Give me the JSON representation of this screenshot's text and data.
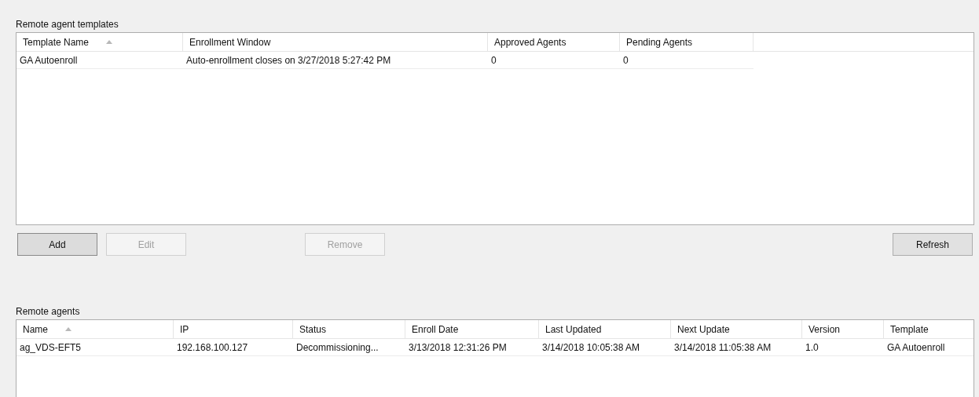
{
  "templates": {
    "label": "Remote agent templates",
    "columns": [
      {
        "title": "Template Name",
        "sorted": true
      },
      {
        "title": "Enrollment Window",
        "sorted": false
      },
      {
        "title": "Approved Agents",
        "sorted": false
      },
      {
        "title": "Pending Agents",
        "sorted": false
      }
    ],
    "rows": [
      [
        "GA Autoenroll",
        "Auto-enrollment closes on 3/27/2018 5:27:42 PM",
        "0",
        "0"
      ]
    ]
  },
  "buttons": [
    {
      "label": "Add",
      "disabled": false,
      "default": true
    },
    {
      "label": "Edit",
      "disabled": true,
      "default": false
    },
    {
      "label": "Remove",
      "disabled": true,
      "default": false
    },
    {
      "label": "Refresh",
      "disabled": false,
      "default": false
    }
  ],
  "agents": {
    "label": "Remote agents",
    "columns": [
      {
        "title": "Name",
        "sorted": true
      },
      {
        "title": "IP",
        "sorted": false
      },
      {
        "title": "Status",
        "sorted": false
      },
      {
        "title": "Enroll Date",
        "sorted": false
      },
      {
        "title": "Last Updated",
        "sorted": false
      },
      {
        "title": "Next Update",
        "sorted": false
      },
      {
        "title": "Version",
        "sorted": false
      },
      {
        "title": "Template",
        "sorted": false
      }
    ],
    "rows": [
      [
        "ag_VDS-EFT5",
        "192.168.100.127",
        "Decommissioning...",
        "3/13/2018 12:31:26 PM",
        "3/14/2018 10:05:38 AM",
        "3/14/2018 11:05:38 AM",
        "1.0",
        "GA Autoenroll"
      ]
    ]
  }
}
